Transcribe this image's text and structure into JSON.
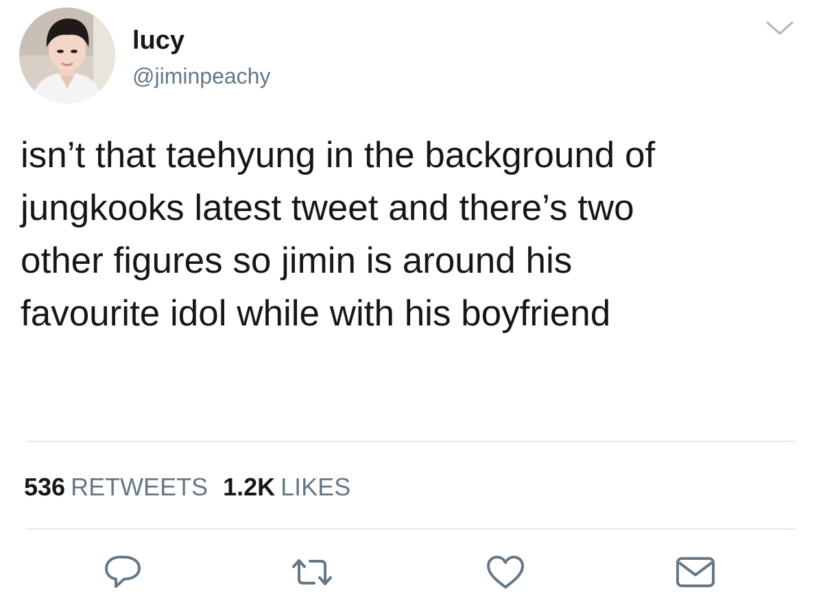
{
  "tweet": {
    "author": {
      "name": "lucy",
      "handle": "@jiminpeachy"
    },
    "text": "isn’t that taehyung in the background of\njungkooks latest tweet and there’s two\nother figures so jimin is around his\nfavourite idol while with his boyfriend",
    "stats": {
      "retweets_count": "536",
      "retweets_label": "RETWEETS",
      "likes_count": "1.2K",
      "likes_label": "LIKES"
    },
    "actions": [
      {
        "name": "reply",
        "icon": "reply-icon"
      },
      {
        "name": "retweet",
        "icon": "retweet-icon"
      },
      {
        "name": "like",
        "icon": "heart-icon"
      },
      {
        "name": "direct-message",
        "icon": "envelope-icon"
      }
    ],
    "menu_icon": "chevron-down-icon"
  },
  "colors": {
    "text_primary": "#14171a",
    "text_secondary": "#657786",
    "icon": "#657786",
    "divider": "#e1e8ed",
    "background": "#ffffff"
  }
}
